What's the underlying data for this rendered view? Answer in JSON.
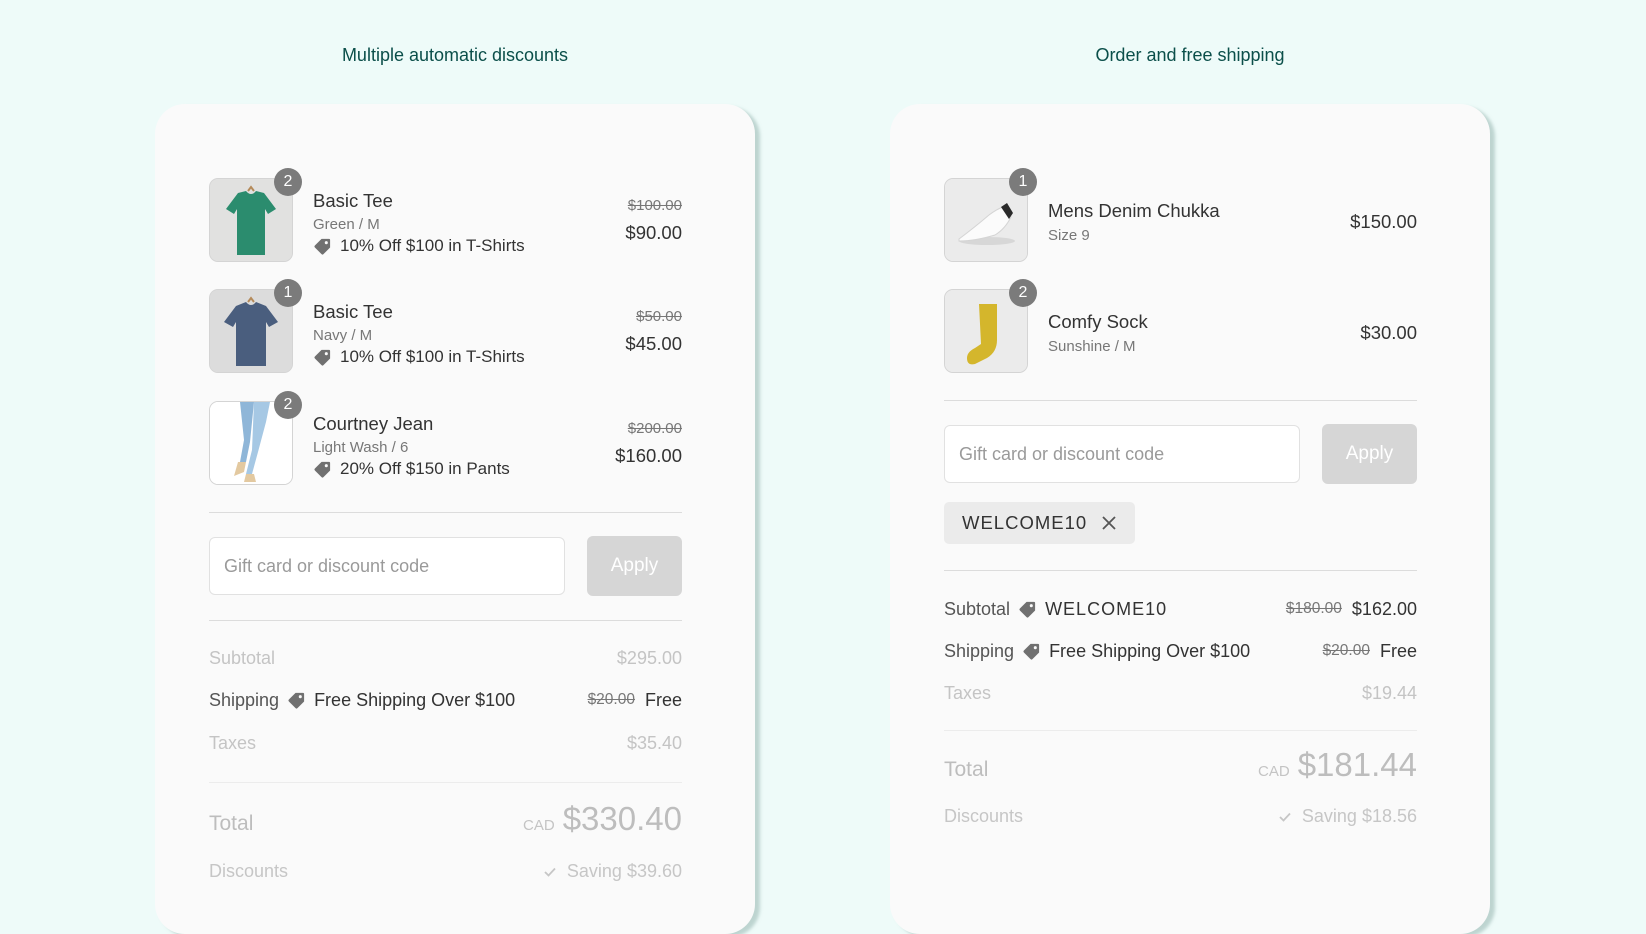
{
  "sections": [
    {
      "title": "Multiple automatic discounts",
      "items": [
        {
          "name": "Basic Tee",
          "variant": "Green / M",
          "qty": "2",
          "discount": "10% Off $100 in T-Shirts",
          "original_price": "$100.00",
          "price": "$90.00",
          "image": "green-tshirt"
        },
        {
          "name": "Basic Tee",
          "variant": "Navy / M",
          "qty": "1",
          "discount": "10% Off $100 in T-Shirts",
          "original_price": "$50.00",
          "price": "$45.00",
          "image": "navy-tshirt"
        },
        {
          "name": "Courtney Jean",
          "variant": "Light Wash / 6",
          "qty": "2",
          "discount": "20% Off $150 in Pants",
          "original_price": "$200.00",
          "price": "$160.00",
          "image": "jeans"
        }
      ],
      "discount_input": {
        "placeholder": "Gift card or discount code",
        "value": ""
      },
      "apply_label": "Apply",
      "summary": {
        "subtotal_label": "Subtotal",
        "subtotal_value": "$295.00",
        "shipping_label": "Shipping",
        "shipping_discount": "Free Shipping Over $100",
        "shipping_original": "$20.00",
        "shipping_value": "Free",
        "taxes_label": "Taxes",
        "taxes_value": "$35.40",
        "total_label": "Total",
        "currency": "CAD",
        "total_value": "$330.40",
        "discounts_label": "Discounts",
        "saving": "Saving $39.60"
      }
    },
    {
      "title": "Order and free shipping",
      "items": [
        {
          "name": "Mens Denim Chukka",
          "variant": "Size 9",
          "qty": "1",
          "price": "$150.00",
          "image": "white-sneaker"
        },
        {
          "name": "Comfy Sock",
          "variant": "Sunshine / M",
          "qty": "2",
          "price": "$30.00",
          "image": "yellow-sock"
        }
      ],
      "discount_input": {
        "placeholder": "Gift card or discount code",
        "value": ""
      },
      "apply_label": "Apply",
      "applied_code": "WELCOME10",
      "summary": {
        "subtotal_label": "Subtotal",
        "subtotal_discount": "WELCOME10",
        "subtotal_original": "$180.00",
        "subtotal_value": "$162.00",
        "shipping_label": "Shipping",
        "shipping_discount": "Free Shipping Over $100",
        "shipping_original": "$20.00",
        "shipping_value": "Free",
        "taxes_label": "Taxes",
        "taxes_value": "$19.44",
        "total_label": "Total",
        "currency": "CAD",
        "total_value": "$181.44",
        "discounts_label": "Discounts",
        "saving": "Saving $18.56"
      }
    }
  ],
  "colors": {
    "background": "#eefbf9",
    "title": "#0b4f4a",
    "card": "#fafafa",
    "apply_disabled": "#d6d6d6"
  }
}
